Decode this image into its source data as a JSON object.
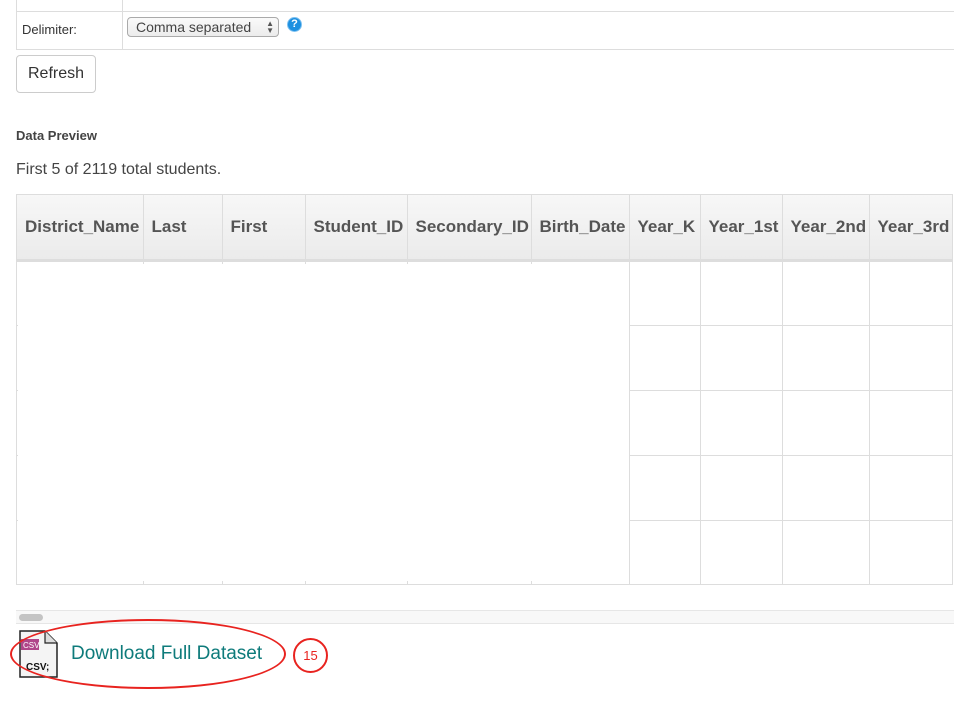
{
  "options": {
    "delimiter_label": "Delimiter:",
    "delimiter_value": "Comma separated",
    "help_icon": "question-circle-icon"
  },
  "refresh_label": "Refresh",
  "preview": {
    "title": "Data Preview",
    "summary": "First 5 of 2119 total students.",
    "columns": [
      "District_Name",
      "Last",
      "First",
      "Student_ID",
      "Secondary_ID",
      "Birth_Date",
      "Year_K",
      "Year_1st",
      "Year_2nd",
      "Year_3rd"
    ],
    "row_count": 5
  },
  "download": {
    "icon": "csv-file-icon",
    "icon_badge": "CSV",
    "icon_text": "CSV;",
    "label": "Download Full Dataset"
  },
  "annotation": {
    "badge": "15",
    "color": "#e8231f"
  },
  "colors": {
    "link": "#0e7b7b",
    "help": "#1e90e0"
  }
}
